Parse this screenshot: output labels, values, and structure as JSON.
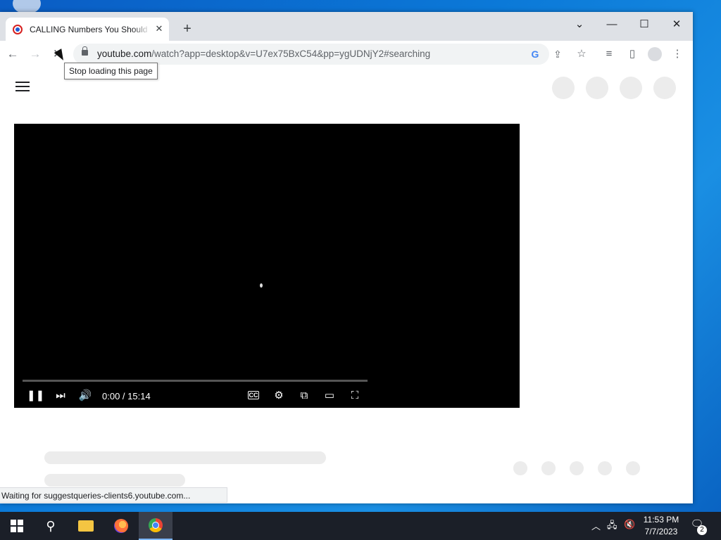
{
  "browser": {
    "tab_title": "CALLING Numbers You Should Never Call",
    "tab_close": "✕",
    "new_tab": "+",
    "url_host": "youtube.com",
    "url_path": "/watch?app=desktop&v=U7ex75BxC54&pp=ygUDNjY2#searching",
    "tooltip": "Stop loading this page",
    "status": "Waiting for suggestqueries-clients6.youtube.com..."
  },
  "player": {
    "time": "0:00 / 15:14",
    "progress_fraction": 0.0
  },
  "taskbar": {
    "time": "11:53 PM",
    "date": "7/7/2023",
    "notification_count": "2"
  },
  "icons": {
    "tab_close": "close-icon",
    "back": "arrow-left-icon",
    "forward": "arrow-right-icon",
    "stop": "close-icon",
    "lock": "lock-icon",
    "google": "google-icon",
    "share": "share-icon",
    "bookmark": "star-icon",
    "media": "media-queue-icon",
    "sidepanel": "side-panel-icon",
    "profile": "profile-icon",
    "menu": "kebab-menu-icon"
  },
  "colors": {
    "tabstrip": "#dee1e6",
    "player_bg": "#000000",
    "taskbar": "#1b1f28",
    "desktop": "#0b79d8"
  }
}
